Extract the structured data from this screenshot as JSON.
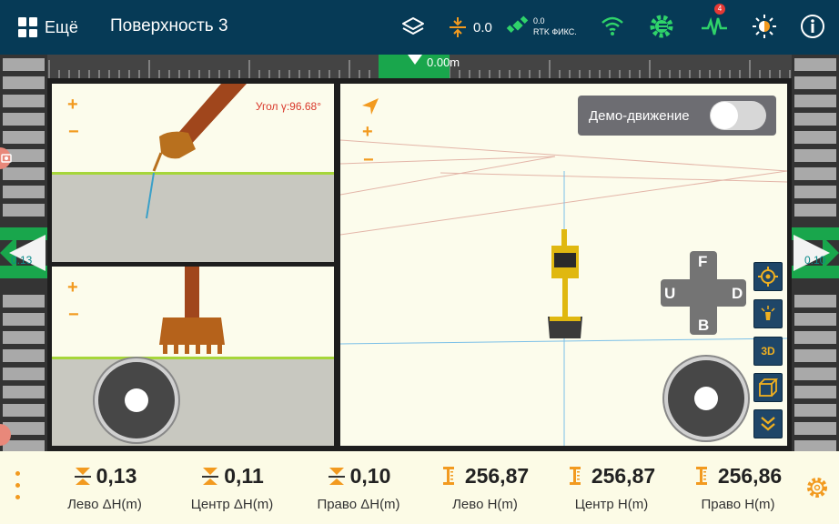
{
  "header": {
    "menu_label": "Ещё",
    "title": "Поверхность 3",
    "offset_value": "0.0",
    "rtk_value": "0.0",
    "rtk_status": "RTK ФИКС.",
    "notification_count": "4"
  },
  "ruler": {
    "value": "0.00m"
  },
  "left_indicator": {
    "value": "0.13"
  },
  "right_indicator": {
    "value": "0.10"
  },
  "side_view": {
    "angle_label": "Угол γ:96.68°",
    "zoom_in": "+",
    "zoom_out": "−"
  },
  "front_view": {
    "zoom_in": "+",
    "zoom_out": "−"
  },
  "plan_view": {
    "zoom_in": "+",
    "zoom_out": "−",
    "demo_label": "Демо-движение",
    "demo_enabled": false,
    "dpad": {
      "up": "F",
      "down": "B",
      "left": "U",
      "right": "D"
    },
    "view_3d_label": "3D"
  },
  "metrics": [
    {
      "value": "0,13",
      "label": "Лево ΔH(m)",
      "icon": "delta-height-icon"
    },
    {
      "value": "0,11",
      "label": "Центр ΔH(m)",
      "icon": "delta-height-icon"
    },
    {
      "value": "0,10",
      "label": "Право ΔH(m)",
      "icon": "delta-height-icon"
    },
    {
      "value": "256,87",
      "label": "Лево H(m)",
      "icon": "height-icon"
    },
    {
      "value": "256,87",
      "label": "Центр H(m)",
      "icon": "height-icon"
    },
    {
      "value": "256,86",
      "label": "Право H(m)",
      "icon": "height-icon"
    }
  ],
  "colors": {
    "header_bg": "#063a56",
    "accent_orange": "#f29a1f",
    "accent_green": "#19a64c",
    "panel_bg": "#fcfcec"
  }
}
